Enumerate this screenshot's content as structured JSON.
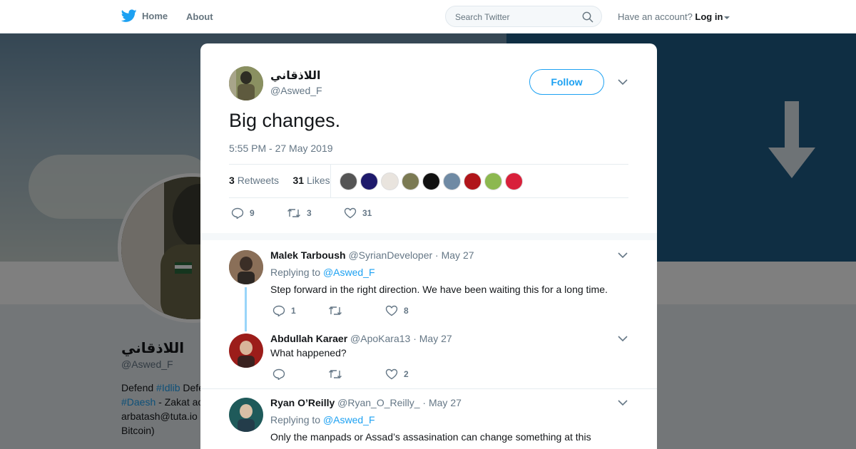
{
  "nav": {
    "home_label": "Home",
    "about_label": "About",
    "search_placeholder": "Search Twitter",
    "account_prompt": "Have an account?",
    "login_label": "Log in"
  },
  "background_profile": {
    "display_name": "اللاذقاني",
    "handle": "@Aswed_F",
    "bio_parts": [
      "Defend ",
      "#Idlib",
      " Defe",
      "#Daesh",
      " - Zakat ac",
      "arbatash@tuta.io",
      "Bitcoin)"
    ]
  },
  "tweet": {
    "display_name": "اللاذقاني",
    "handle": "@Aswed_F",
    "follow_label": "Follow",
    "text": "Big changes.",
    "timestamp": "5:55 PM - 27 May 2019",
    "retweets_count": "3",
    "retweets_label": "Retweets",
    "likes_count": "31",
    "likes_label": "Likes",
    "reply_count": "9",
    "retweet_count": "3",
    "like_count": "31",
    "liker_colors": [
      "#555555",
      "#1e1a6b",
      "#e9e4de",
      "#7b7a53",
      "#111111",
      "#6f8aa4",
      "#b0151a",
      "#8cb84f",
      "#d8203a"
    ]
  },
  "replies": [
    {
      "name": "Malek Tarboush",
      "handle": "@SyrianDeveloper",
      "date": "May 27",
      "replying_prefix": "Replying to",
      "replying_to": "@Aswed_F",
      "text": "Step forward in the right direction. We have been waiting this for a long time.",
      "reply_count": "1",
      "retweet_count": "",
      "like_count": "8"
    },
    {
      "name": "Abdullah Karaer",
      "handle": "@ApoKara13",
      "date": "May 27",
      "text": "What happened?",
      "reply_count": "",
      "retweet_count": "",
      "like_count": "2"
    },
    {
      "name": "Ryan O’Reilly",
      "handle": "@Ryan_O_Reilly_",
      "date": "May 27",
      "replying_prefix": "Replying to",
      "replying_to": "@Aswed_F",
      "text": "Only the manpads or Assad’s assasination can change something at this"
    }
  ],
  "colors": {
    "accent": "#1da1f2",
    "muted_text": "#657786"
  }
}
